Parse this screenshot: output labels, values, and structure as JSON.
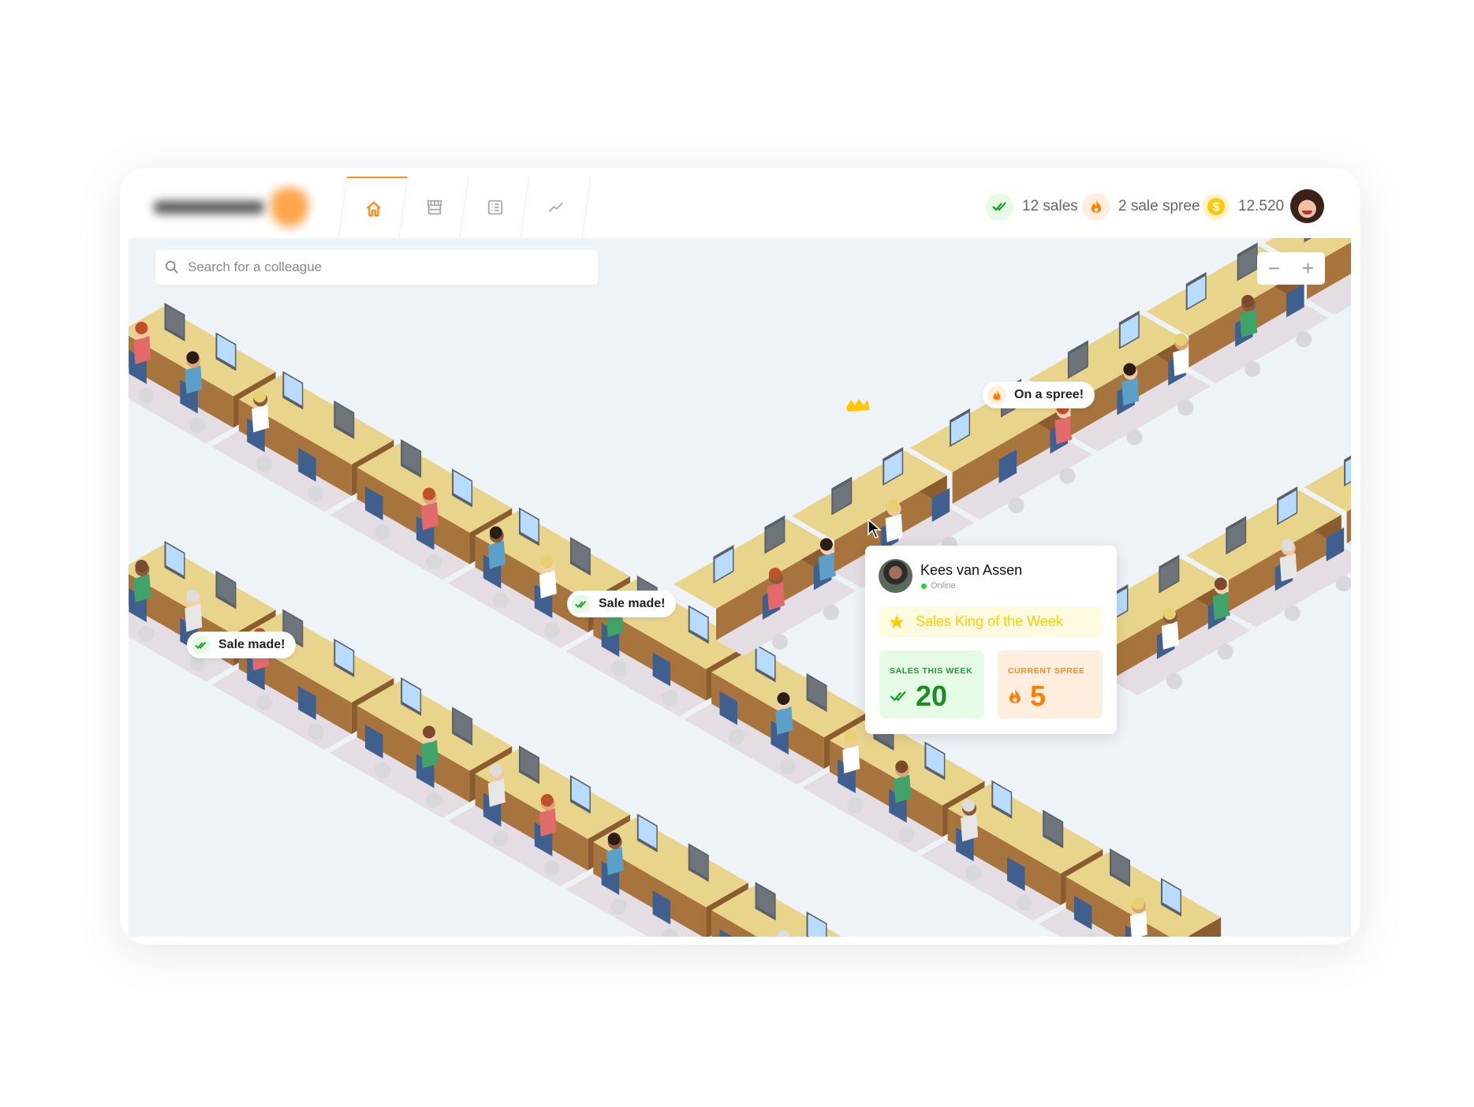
{
  "header": {
    "tabs": [
      {
        "name": "home",
        "icon": "home-icon",
        "active": true
      },
      {
        "name": "shop",
        "icon": "store-icon",
        "active": false
      },
      {
        "name": "list",
        "icon": "list-icon",
        "active": false
      },
      {
        "name": "stats",
        "icon": "trend-icon",
        "active": false
      }
    ],
    "stats": {
      "sales": "12 sales",
      "spree": "2 sale spree",
      "coins": "12.520"
    },
    "colors": {
      "accent": "#ff8a1f",
      "green": "#1a9e2a",
      "orange": "#ff8000",
      "gold": "#ffc800"
    }
  },
  "search": {
    "placeholder": "Search for a colleague",
    "value": ""
  },
  "zoom": {
    "minus": "−",
    "plus": "+"
  },
  "bubbles": [
    {
      "text": "On a spree!",
      "icon": "fire-icon"
    },
    {
      "text": "Sale made!",
      "icon": "double-check-icon"
    },
    {
      "text": "Sale made!",
      "icon": "double-check-icon"
    }
  ],
  "popup": {
    "name": "Kees van Assen",
    "status": "Online",
    "badge": "Sales King of the Week",
    "sales_label": "SALES THIS WEEK",
    "sales_value": "20",
    "spree_label": "CURRENT SPREE",
    "spree_value": "5"
  }
}
